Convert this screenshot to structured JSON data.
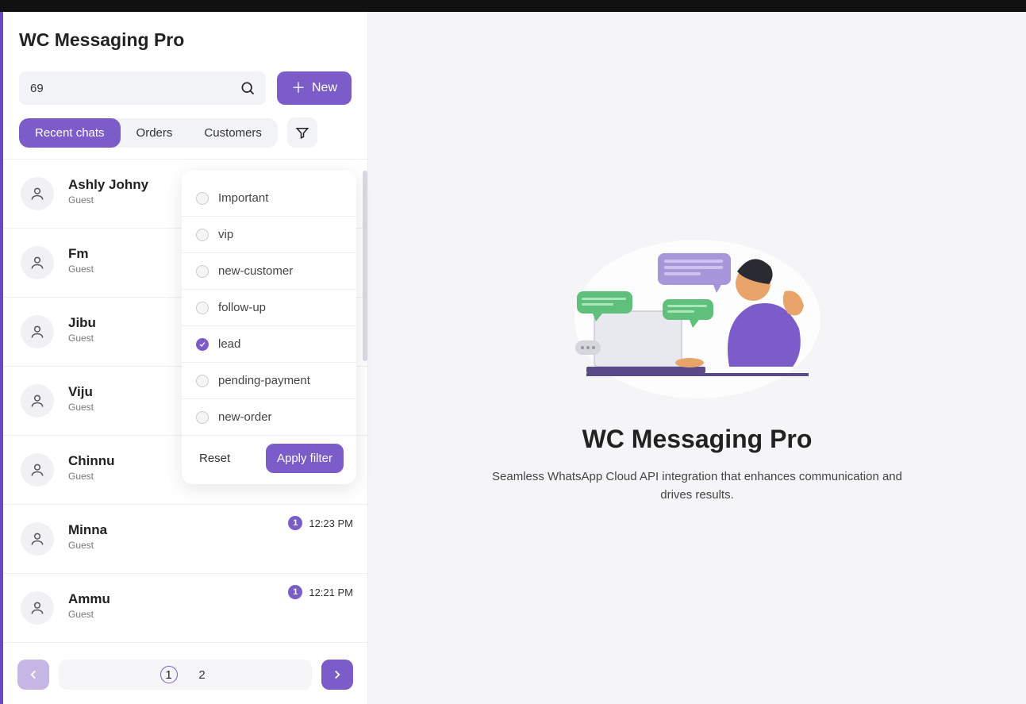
{
  "app_title": "WC Messaging Pro",
  "search": {
    "value": "69"
  },
  "new_button": "New",
  "tabs": {
    "recent": "Recent chats",
    "orders": "Orders",
    "customers": "Customers",
    "active": "recent"
  },
  "filters": {
    "options": [
      {
        "label": "Important",
        "selected": false
      },
      {
        "label": "vip",
        "selected": false
      },
      {
        "label": "new-customer",
        "selected": false
      },
      {
        "label": "follow-up",
        "selected": false
      },
      {
        "label": "lead",
        "selected": true
      },
      {
        "label": "pending-payment",
        "selected": false
      },
      {
        "label": "new-order",
        "selected": false
      }
    ],
    "reset": "Reset",
    "apply": "Apply filter"
  },
  "chats": [
    {
      "name": "Ashly Johny",
      "sub": "Guest",
      "badge": "",
      "time": ""
    },
    {
      "name": "Fm",
      "sub": "Guest",
      "badge": "",
      "time": ""
    },
    {
      "name": "Jibu",
      "sub": "Guest",
      "badge": "",
      "time": ""
    },
    {
      "name": "Viju",
      "sub": "Guest",
      "badge": "",
      "time": ""
    },
    {
      "name": "Chinnu",
      "sub": "Guest",
      "badge": "",
      "time": ""
    },
    {
      "name": "Minna",
      "sub": "Guest",
      "badge": "1",
      "time": "12:23 PM"
    },
    {
      "name": "Ammu",
      "sub": "Guest",
      "badge": "1",
      "time": "12:21 PM"
    }
  ],
  "pagination": {
    "pages": [
      "1",
      "2"
    ],
    "active": "1"
  },
  "empty_state": {
    "title": "WC Messaging Pro",
    "subtitle": "Seamless WhatsApp Cloud API integration that enhances communication and drives results."
  }
}
